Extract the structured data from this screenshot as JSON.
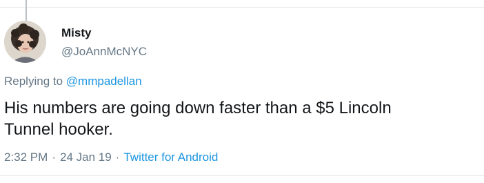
{
  "author": {
    "display_name": "Misty",
    "handle": "@JoAnnMcNYC",
    "avatar": "avatar-photo"
  },
  "reply": {
    "prefix": "Replying to ",
    "target": "@mmpadellan"
  },
  "tweet": {
    "text": "His numbers are going down faster than a $5 Lincoln\nTunnel hooker."
  },
  "meta": {
    "time": "2:32 PM",
    "separator": "·",
    "date": "24 Jan 19",
    "source": "Twitter for Android"
  },
  "colors": {
    "text": "#14171a",
    "secondary": "#657786",
    "link": "#1b95e0",
    "divider": "#e1e8ed"
  }
}
